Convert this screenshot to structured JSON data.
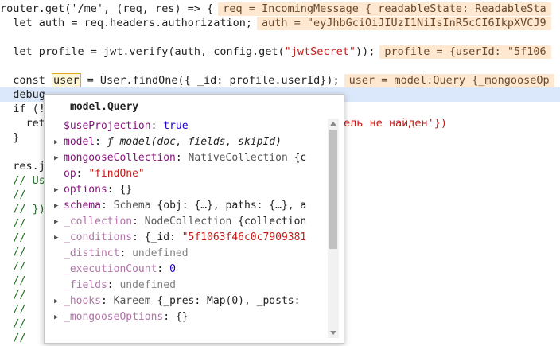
{
  "code": {
    "line1": {
      "text": "router.get('/me', (req, res) => {",
      "inline": "req = IncomingMessage {_readableState: ReadableSta"
    },
    "line2": {
      "text": "  let auth = req.headers.authorization;",
      "inline": "auth = \"eyJhbGciOiJIUzI1NiIsInR5cCI6IkpXVCJ9"
    },
    "line3": {
      "text": ""
    },
    "line4": {
      "pre": "  let profile = jwt.verify(auth, config.get(",
      "str": "\"jwtSecret\"",
      "post": "));",
      "inline": "profile = {userId: \"5f106"
    },
    "line5": {
      "pre": "  const ",
      "token": "user",
      "post": " = User.findOne({ _id: profile.userId});",
      "inline": "user = model.Query {_mongooseOp"
    },
    "line6": {
      "text": "  debug"
    },
    "line7": {
      "text": "  if (!"
    },
    "line8": {
      "pre": "    ret",
      "tail": "ель не найден'})"
    },
    "line9": {
      "text": "  }"
    },
    "line10": {
      "text": ""
    },
    "line11": {
      "text": "  res.j"
    },
    "line12": {
      "text": "  // Us"
    },
    "line13": {
      "text": "  //"
    },
    "line14": {
      "text": "  // })"
    },
    "line15": {
      "text": "  //"
    },
    "line16": {
      "text": "  //"
    },
    "line17": {
      "text": "  //"
    },
    "line18": {
      "text": "  //"
    },
    "line19": {
      "text": "  //"
    },
    "line20": {
      "text": "  //"
    },
    "line21": {
      "text": "  //"
    },
    "line22": {
      "text": "  //"
    },
    "line23": {
      "text": "  //"
    }
  },
  "popover": {
    "title": "model.Query",
    "props": [
      {
        "key": "$useProjection",
        "value": "true",
        "vtype": "bool",
        "expandable": false
      },
      {
        "key": "model",
        "value": "ƒ model(doc, fields, skipId)",
        "vtype": "fn",
        "expandable": true
      },
      {
        "key": "mongooseCollection",
        "value": "NativeCollection {c",
        "vtype": "obj",
        "expandable": true
      },
      {
        "key": "op",
        "value": "\"findOne\"",
        "vtype": "str",
        "expandable": false
      },
      {
        "key": "options",
        "value": "{}",
        "vtype": "obj",
        "expandable": true
      },
      {
        "key": "schema",
        "value": "Schema {obj: {…}, paths: {…}, a",
        "vtype": "obj",
        "expandable": true
      },
      {
        "key": "_collection",
        "value": "NodeCollection {collection",
        "vtype": "obj",
        "expandable": true
      },
      {
        "key": "_conditions",
        "value": "{_id: \"5f1063f46c0c7909381",
        "vtype": "cond",
        "expandable": true
      },
      {
        "key": "_distinct",
        "value": "undefined",
        "vtype": "undef",
        "expandable": false
      },
      {
        "key": "_executionCount",
        "value": "0",
        "vtype": "num",
        "expandable": false
      },
      {
        "key": "_fields",
        "value": "undefined",
        "vtype": "undef",
        "expandable": false
      },
      {
        "key": "_hooks",
        "value": "Kareem {_pres: Map(0), _posts: ",
        "vtype": "obj",
        "expandable": true
      },
      {
        "key": "_mongooseOptions",
        "value": "{}",
        "vtype": "obj",
        "expandable": true
      }
    ]
  },
  "colors": {
    "inline_bg": "#ffe8d2",
    "debug_line_bg": "#dbe7fb",
    "token_border": "#e0a91b"
  }
}
